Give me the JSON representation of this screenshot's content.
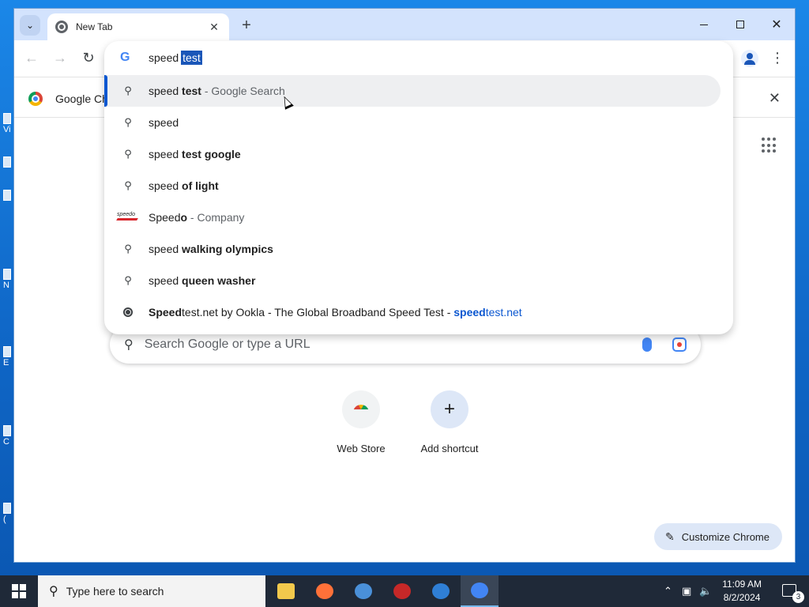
{
  "desktop": {
    "icons": [
      {
        "label": "Vi"
      },
      {
        "label": ""
      },
      {
        "label": ""
      },
      {
        "label": "N"
      },
      {
        "label": "E"
      },
      {
        "label": "C"
      },
      {
        "label": "("
      }
    ]
  },
  "browser": {
    "tab": {
      "title": "New Tab",
      "icon": "chrome-icon"
    },
    "window_controls": {
      "minimize": "minimize-icon",
      "maximize": "maximize-icon",
      "close": "close-icon"
    },
    "infobar": {
      "text": "Google Ch"
    },
    "omnibox": {
      "typed_text": "speed",
      "selected_completion": "test",
      "suggestions": [
        {
          "icon": "search-icon",
          "parts": [
            {
              "t": "speed ",
              "b": false
            },
            {
              "t": "test",
              "b": true
            },
            {
              "t": " - Google Search",
              "dim": true
            }
          ],
          "active": true
        },
        {
          "icon": "search-icon",
          "parts": [
            {
              "t": "speed",
              "b": false
            }
          ]
        },
        {
          "icon": "search-icon",
          "parts": [
            {
              "t": "speed ",
              "b": false
            },
            {
              "t": "test google",
              "b": true
            }
          ]
        },
        {
          "icon": "search-icon",
          "parts": [
            {
              "t": "speed ",
              "b": false
            },
            {
              "t": "of light",
              "b": true
            }
          ]
        },
        {
          "icon": "speedo-logo",
          "parts": [
            {
              "t": "Speed",
              "b": false
            },
            {
              "t": "o",
              "b": true
            },
            {
              "t": " - Company",
              "dim": true
            }
          ]
        },
        {
          "icon": "search-icon",
          "parts": [
            {
              "t": "speed ",
              "b": false
            },
            {
              "t": "walking olympics",
              "b": true
            }
          ]
        },
        {
          "icon": "search-icon",
          "parts": [
            {
              "t": "speed ",
              "b": false
            },
            {
              "t": "queen washer",
              "b": true
            }
          ]
        },
        {
          "icon": "globe-icon",
          "parts": [
            {
              "t": "Speed",
              "b": true
            },
            {
              "t": "test.net by Ookla - The Global Broadband Speed Test - ",
              "b": false
            },
            {
              "t": "speed",
              "b": true,
              "url": true
            },
            {
              "t": "test.net",
              "url": true
            }
          ]
        }
      ]
    },
    "ntp": {
      "search_placeholder": "Search Google or type a URL",
      "shortcuts": [
        {
          "label": "Web Store",
          "icon": "webstore-icon"
        },
        {
          "label": "Add shortcut",
          "icon": "plus-icon"
        }
      ],
      "customize_label": "Customize Chrome"
    }
  },
  "taskbar": {
    "search_placeholder": "Type here to search",
    "apps": [
      {
        "name": "file-explorer",
        "color": "#f2c94c"
      },
      {
        "name": "firefox",
        "color": "#ff7139"
      },
      {
        "name": "chromium",
        "color": "#4a90d9"
      },
      {
        "name": "app-red",
        "color": "#c62828"
      },
      {
        "name": "app-blue",
        "color": "#2f7fd6"
      },
      {
        "name": "chrome",
        "color": "#4285f4",
        "active": true
      }
    ],
    "time": "11:09 AM",
    "date": "8/2/2024",
    "notification_count": "3"
  }
}
